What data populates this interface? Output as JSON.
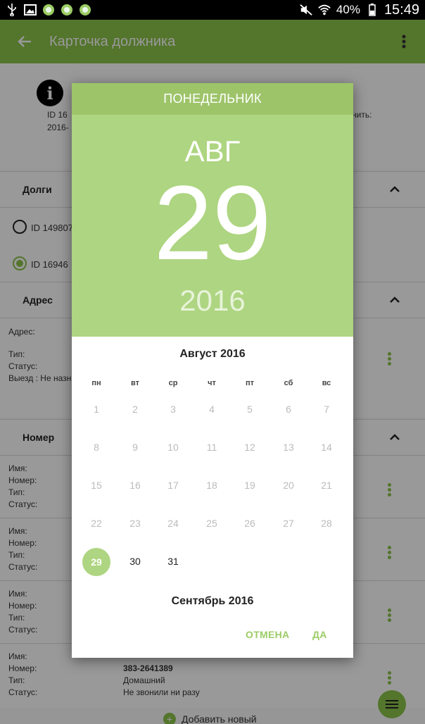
{
  "status_bar": {
    "battery": "40%",
    "time": "15:49"
  },
  "app_bar": {
    "title": "Карточка должника"
  },
  "background": {
    "top_card": {
      "line1": "ID 16",
      "line1_right": "нить:",
      "line2": "2016-"
    },
    "sections": {
      "debts": "Долги",
      "address": "Адрес",
      "number": "Номер"
    },
    "debt_items": [
      "ID 149807",
      "ID 16946"
    ],
    "address_labels": {
      "address": "Адрес:",
      "type": "Тип:",
      "status": "Статус:",
      "visit": "Выезд : Не назн"
    },
    "contact_labels": {
      "name": "Имя:",
      "number": "Номер:",
      "type": "Тип:",
      "status": "Статус:"
    },
    "last_contact": {
      "number": "383-2641389",
      "type": "Домашний",
      "status": "Не звонили ни разу"
    },
    "add_new": "Добавить новый"
  },
  "dialog": {
    "weekday": "ПОНЕДЕЛЬНИК",
    "month": "АВГ",
    "day": "29",
    "year": "2016",
    "calendar_title": "Август 2016",
    "next_month": "Сентябрь 2016",
    "weekdays": [
      "пн",
      "вт",
      "ср",
      "чт",
      "пт",
      "сб",
      "вс"
    ],
    "days": [
      "1",
      "2",
      "3",
      "4",
      "5",
      "6",
      "7",
      "8",
      "9",
      "10",
      "11",
      "12",
      "13",
      "14",
      "15",
      "16",
      "17",
      "18",
      "19",
      "20",
      "21",
      "22",
      "23",
      "24",
      "25",
      "26",
      "27",
      "28",
      "29",
      "30",
      "31"
    ],
    "selected_day": "29",
    "cancel_label": "ОТМЕНА",
    "ok_label": "ДА"
  },
  "colors": {
    "accent": "#8bc34a",
    "header": "#aed581",
    "weekday_bar": "#9ec46a"
  }
}
